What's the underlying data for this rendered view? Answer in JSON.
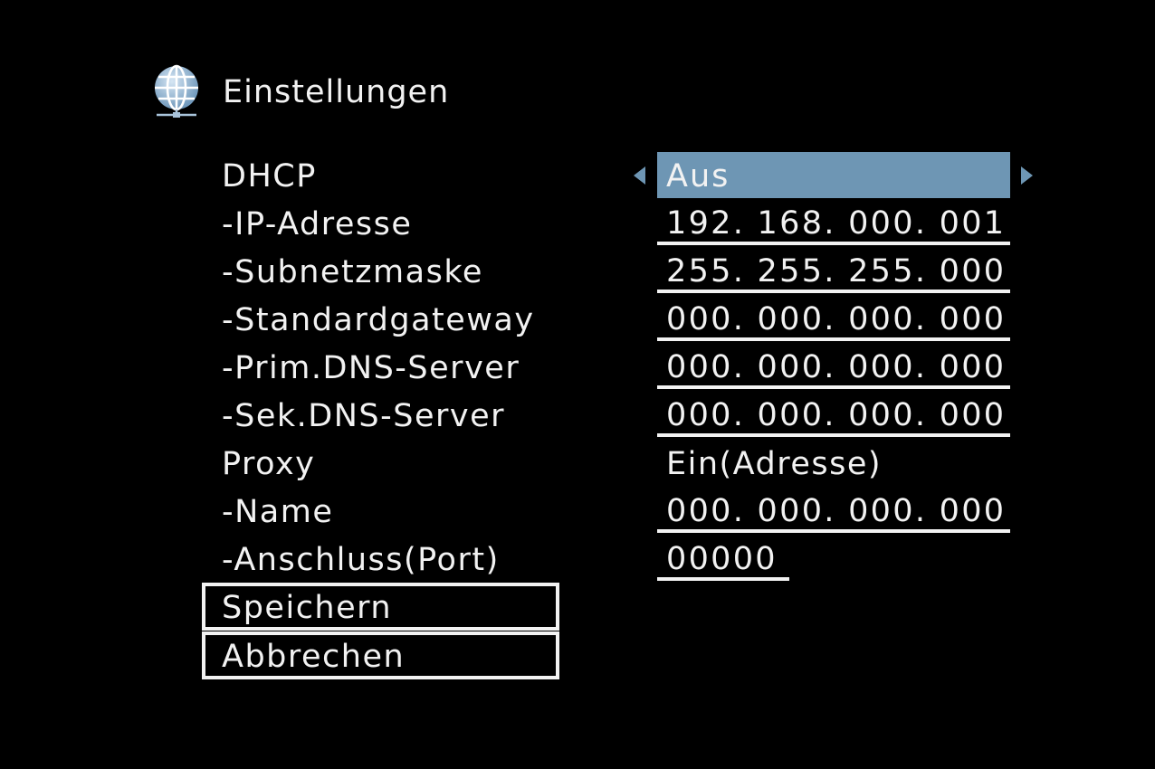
{
  "header": {
    "icon": "globe-network-icon",
    "title": "Einstellungen"
  },
  "accent_color": "#6e96b4",
  "settings": {
    "dhcp": {
      "label": "DHCP",
      "value": "Aus"
    },
    "ip_address": {
      "label": "-IP-Adresse",
      "value": "192. 168. 000. 001"
    },
    "subnet_mask": {
      "label": "-Subnetzmaske",
      "value": "255. 255. 255. 000"
    },
    "default_gateway": {
      "label": "-Standardgateway",
      "value": "000. 000. 000. 000"
    },
    "primary_dns": {
      "label": "-Prim.DNS-Server",
      "value": "000. 000. 000. 000"
    },
    "secondary_dns": {
      "label": "-Sek.DNS-Server",
      "value": "000. 000. 000. 000"
    },
    "proxy": {
      "label": "Proxy",
      "value": "Ein(Adresse)"
    },
    "proxy_name": {
      "label": "-Name",
      "value": "000. 000. 000. 000"
    },
    "proxy_port": {
      "label": "-Anschluss(Port)",
      "value": "00000"
    }
  },
  "buttons": {
    "save": "Speichern",
    "cancel": "Abbrechen"
  }
}
